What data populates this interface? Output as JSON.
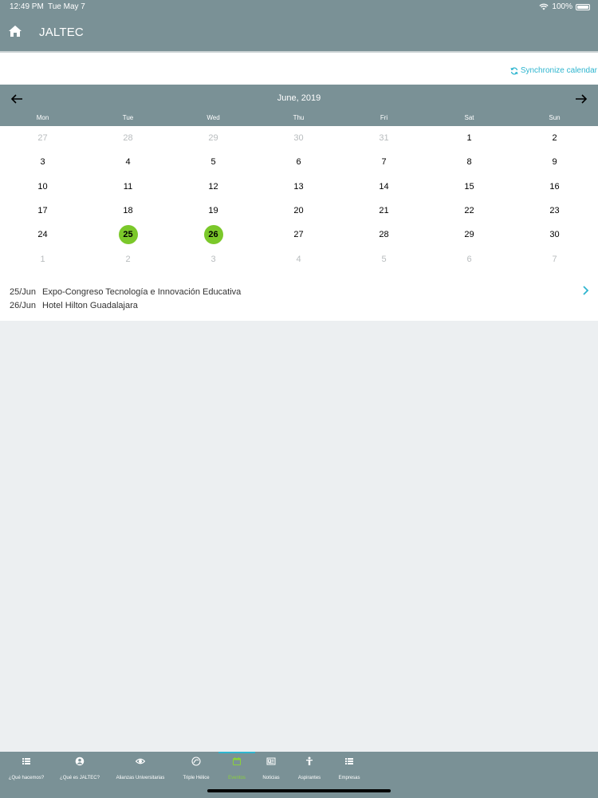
{
  "status_bar": {
    "time": "12:49 PM",
    "date": "Tue May 7",
    "battery": "100%"
  },
  "header": {
    "title": "JALTEC"
  },
  "sync": {
    "label": "Synchronize calendar"
  },
  "calendar": {
    "month": "June, 2019",
    "weekdays": [
      "Mon",
      "Tue",
      "Wed",
      "Thu",
      "Fri",
      "Sat",
      "Sun"
    ],
    "weeks": [
      [
        {
          "d": "27",
          "dim": true
        },
        {
          "d": "28",
          "dim": true
        },
        {
          "d": "29",
          "dim": true
        },
        {
          "d": "30",
          "dim": true
        },
        {
          "d": "31",
          "dim": true
        },
        {
          "d": "1"
        },
        {
          "d": "2"
        }
      ],
      [
        {
          "d": "3"
        },
        {
          "d": "4"
        },
        {
          "d": "5"
        },
        {
          "d": "6"
        },
        {
          "d": "7"
        },
        {
          "d": "8"
        },
        {
          "d": "9"
        }
      ],
      [
        {
          "d": "10"
        },
        {
          "d": "11"
        },
        {
          "d": "12"
        },
        {
          "d": "13"
        },
        {
          "d": "14"
        },
        {
          "d": "15"
        },
        {
          "d": "16"
        }
      ],
      [
        {
          "d": "17"
        },
        {
          "d": "18"
        },
        {
          "d": "19"
        },
        {
          "d": "20"
        },
        {
          "d": "21"
        },
        {
          "d": "22"
        },
        {
          "d": "23"
        }
      ],
      [
        {
          "d": "24"
        },
        {
          "d": "25",
          "event": true
        },
        {
          "d": "26",
          "event": true
        },
        {
          "d": "27"
        },
        {
          "d": "28"
        },
        {
          "d": "29"
        },
        {
          "d": "30"
        }
      ],
      [
        {
          "d": "1",
          "dim": true
        },
        {
          "d": "2",
          "dim": true
        },
        {
          "d": "3",
          "dim": true
        },
        {
          "d": "4",
          "dim": true
        },
        {
          "d": "5",
          "dim": true
        },
        {
          "d": "6",
          "dim": true
        },
        {
          "d": "7",
          "dim": true
        }
      ]
    ]
  },
  "events": [
    {
      "date": "25/Jun",
      "title": "Expo-Congreso Tecnología e Innovación Educativa"
    },
    {
      "date": "26/Jun",
      "title": "Hotel Hilton Guadalajara"
    }
  ],
  "tabs": [
    {
      "label": "¿Qué hacemos?",
      "icon": "list-icon"
    },
    {
      "label": "¿Qué es JALTEC?",
      "icon": "user-circle-icon"
    },
    {
      "label": "Alianzas Universitarias",
      "icon": "eye-icon"
    },
    {
      "label": "Triple Hélice",
      "icon": "helix-icon"
    },
    {
      "label": "Eventos",
      "icon": "calendar-icon",
      "active": true
    },
    {
      "label": "Noticias",
      "icon": "newspaper-icon"
    },
    {
      "label": "Aspirantes",
      "icon": "person-icon"
    },
    {
      "label": "Empresas",
      "icon": "list-icon"
    }
  ],
  "colors": {
    "header": "#7a9196",
    "accent": "#2eb5cf",
    "event": "#7bc82a"
  }
}
